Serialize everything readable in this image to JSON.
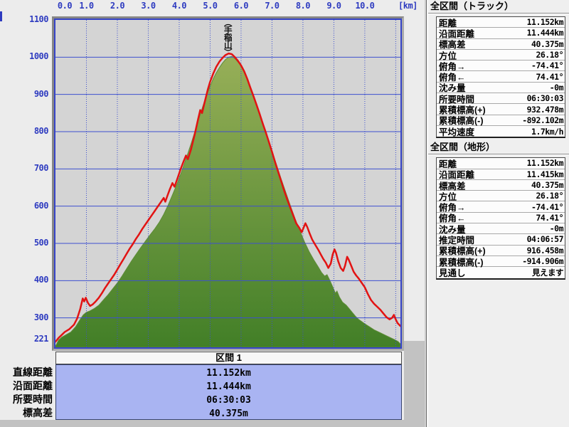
{
  "chart": {
    "x_unit_label": "[km]"
  },
  "chart_data": {
    "type": "area",
    "title": "",
    "xlabel": "[km]",
    "ylabel": "",
    "xlim": [
      0,
      11.152
    ],
    "ylim": [
      221,
      1100
    ],
    "x_ticks": [
      "0.0",
      "1.0",
      "2.0",
      "3.0",
      "4.0",
      "5.0",
      "6.0",
      "7.0",
      "8.0",
      "9.0",
      "10.0"
    ],
    "y_ticks": [
      "1100",
      "1000",
      "900",
      "800",
      "700",
      "600",
      "500",
      "400",
      "300",
      "221"
    ],
    "grid": true,
    "legend": "none",
    "annotations": [
      {
        "x": 5.56,
        "label": "（手稲山）"
      }
    ],
    "colors": {
      "axis_label": "#2e3bc0",
      "grid": "#3e50cf",
      "plot_bg": "#d4d4d4",
      "terrain_top": "#97af58",
      "terrain_bottom": "#427f27",
      "terrain_edge": "#5d8c36",
      "track": "#e21313",
      "section_value_bg": "#a9b4f2"
    },
    "series": [
      {
        "name": "地形",
        "style": "area-gradient",
        "points": [
          [
            0,
            224
          ],
          [
            0.05,
            232
          ],
          [
            0.1,
            240
          ],
          [
            0.2,
            248
          ],
          [
            0.35,
            255
          ],
          [
            0.5,
            262
          ],
          [
            0.65,
            276
          ],
          [
            0.8,
            296
          ],
          [
            0.9,
            308
          ],
          [
            1.0,
            315
          ],
          [
            1.1,
            318
          ],
          [
            1.25,
            325
          ],
          [
            1.4,
            334
          ],
          [
            1.55,
            348
          ],
          [
            1.7,
            362
          ],
          [
            1.85,
            378
          ],
          [
            2.0,
            394
          ],
          [
            2.15,
            412
          ],
          [
            2.3,
            432
          ],
          [
            2.45,
            452
          ],
          [
            2.6,
            470
          ],
          [
            2.75,
            488
          ],
          [
            2.9,
            505
          ],
          [
            3.05,
            522
          ],
          [
            3.2,
            538
          ],
          [
            3.35,
            556
          ],
          [
            3.5,
            578
          ],
          [
            3.65,
            604
          ],
          [
            3.8,
            634
          ],
          [
            3.95,
            664
          ],
          [
            4.1,
            698
          ],
          [
            4.25,
            734
          ],
          [
            4.4,
            772
          ],
          [
            4.55,
            812
          ],
          [
            4.7,
            852
          ],
          [
            4.85,
            890
          ],
          [
            5.0,
            922
          ],
          [
            5.1,
            942
          ],
          [
            5.2,
            958
          ],
          [
            5.3,
            972
          ],
          [
            5.4,
            984
          ],
          [
            5.5,
            994
          ],
          [
            5.6,
            1000
          ],
          [
            5.7,
            1002
          ],
          [
            5.78,
            998
          ],
          [
            5.85,
            992
          ],
          [
            5.95,
            982
          ],
          [
            6.05,
            968
          ],
          [
            6.15,
            950
          ],
          [
            6.25,
            928
          ],
          [
            6.4,
            894
          ],
          [
            6.55,
            860
          ],
          [
            6.7,
            824
          ],
          [
            6.85,
            786
          ],
          [
            7.0,
            748
          ],
          [
            7.15,
            710
          ],
          [
            7.3,
            672
          ],
          [
            7.45,
            636
          ],
          [
            7.6,
            600
          ],
          [
            7.75,
            566
          ],
          [
            7.9,
            534
          ],
          [
            8.05,
            504
          ],
          [
            8.2,
            478
          ],
          [
            8.35,
            456
          ],
          [
            8.5,
            436
          ],
          [
            8.6,
            422
          ],
          [
            8.7,
            412
          ],
          [
            8.78,
            416
          ],
          [
            8.85,
            404
          ],
          [
            8.95,
            386
          ],
          [
            9.05,
            366
          ],
          [
            9.1,
            372
          ],
          [
            9.18,
            356
          ],
          [
            9.28,
            342
          ],
          [
            9.4,
            334
          ],
          [
            9.5,
            324
          ],
          [
            9.6,
            314
          ],
          [
            9.7,
            304
          ],
          [
            9.8,
            296
          ],
          [
            9.9,
            290
          ],
          [
            10.0,
            284
          ],
          [
            10.15,
            276
          ],
          [
            10.3,
            268
          ],
          [
            10.5,
            260
          ],
          [
            10.7,
            252
          ],
          [
            10.9,
            244
          ],
          [
            11.0,
            240
          ],
          [
            11.08,
            236
          ],
          [
            11.152,
            230
          ]
        ]
      },
      {
        "name": "トラック",
        "style": "line",
        "points": [
          [
            0,
            236
          ],
          [
            0.1,
            246
          ],
          [
            0.2,
            254
          ],
          [
            0.3,
            262
          ],
          [
            0.45,
            270
          ],
          [
            0.6,
            282
          ],
          [
            0.7,
            298
          ],
          [
            0.8,
            324
          ],
          [
            0.88,
            352
          ],
          [
            0.93,
            344
          ],
          [
            0.98,
            354
          ],
          [
            1.05,
            340
          ],
          [
            1.12,
            332
          ],
          [
            1.2,
            336
          ],
          [
            1.3,
            344
          ],
          [
            1.4,
            354
          ],
          [
            1.5,
            366
          ],
          [
            1.6,
            380
          ],
          [
            1.7,
            392
          ],
          [
            1.8,
            404
          ],
          [
            1.9,
            416
          ],
          [
            2.0,
            430
          ],
          [
            2.1,
            444
          ],
          [
            2.2,
            458
          ],
          [
            2.3,
            472
          ],
          [
            2.4,
            486
          ],
          [
            2.5,
            498
          ],
          [
            2.6,
            512
          ],
          [
            2.7,
            524
          ],
          [
            2.8,
            538
          ],
          [
            2.9,
            550
          ],
          [
            3.0,
            562
          ],
          [
            3.1,
            574
          ],
          [
            3.2,
            586
          ],
          [
            3.3,
            598
          ],
          [
            3.4,
            610
          ],
          [
            3.5,
            622
          ],
          [
            3.55,
            612
          ],
          [
            3.62,
            628
          ],
          [
            3.7,
            646
          ],
          [
            3.78,
            662
          ],
          [
            3.85,
            652
          ],
          [
            3.95,
            676
          ],
          [
            4.05,
            700
          ],
          [
            4.15,
            722
          ],
          [
            4.22,
            736
          ],
          [
            4.28,
            726
          ],
          [
            4.38,
            752
          ],
          [
            4.5,
            792
          ],
          [
            4.6,
            830
          ],
          [
            4.68,
            858
          ],
          [
            4.74,
            850
          ],
          [
            4.82,
            878
          ],
          [
            4.92,
            912
          ],
          [
            5.0,
            934
          ],
          [
            5.1,
            956
          ],
          [
            5.2,
            974
          ],
          [
            5.3,
            988
          ],
          [
            5.4,
            998
          ],
          [
            5.5,
            1006
          ],
          [
            5.6,
            1010
          ],
          [
            5.7,
            1008
          ],
          [
            5.8,
            1000
          ],
          [
            5.9,
            990
          ],
          [
            6.0,
            978
          ],
          [
            6.1,
            962
          ],
          [
            6.2,
            942
          ],
          [
            6.3,
            918
          ],
          [
            6.4,
            896
          ],
          [
            6.5,
            872
          ],
          [
            6.6,
            848
          ],
          [
            6.7,
            822
          ],
          [
            6.8,
            798
          ],
          [
            6.9,
            772
          ],
          [
            7.0,
            746
          ],
          [
            7.1,
            718
          ],
          [
            7.2,
            692
          ],
          [
            7.3,
            666
          ],
          [
            7.4,
            640
          ],
          [
            7.5,
            616
          ],
          [
            7.6,
            594
          ],
          [
            7.7,
            572
          ],
          [
            7.78,
            554
          ],
          [
            7.88,
            542
          ],
          [
            7.96,
            530
          ],
          [
            8.02,
            542
          ],
          [
            8.08,
            554
          ],
          [
            8.14,
            544
          ],
          [
            8.22,
            526
          ],
          [
            8.3,
            510
          ],
          [
            8.4,
            496
          ],
          [
            8.5,
            482
          ],
          [
            8.58,
            470
          ],
          [
            8.66,
            458
          ],
          [
            8.74,
            448
          ],
          [
            8.82,
            434
          ],
          [
            8.9,
            446
          ],
          [
            8.96,
            470
          ],
          [
            9.02,
            484
          ],
          [
            9.07,
            474
          ],
          [
            9.14,
            452
          ],
          [
            9.22,
            434
          ],
          [
            9.3,
            426
          ],
          [
            9.36,
            440
          ],
          [
            9.43,
            464
          ],
          [
            9.48,
            456
          ],
          [
            9.56,
            440
          ],
          [
            9.64,
            424
          ],
          [
            9.72,
            414
          ],
          [
            9.8,
            406
          ],
          [
            9.9,
            394
          ],
          [
            10.0,
            382
          ],
          [
            10.1,
            364
          ],
          [
            10.2,
            348
          ],
          [
            10.3,
            338
          ],
          [
            10.4,
            330
          ],
          [
            10.5,
            322
          ],
          [
            10.6,
            312
          ],
          [
            10.7,
            302
          ],
          [
            10.8,
            296
          ],
          [
            10.88,
            300
          ],
          [
            10.94,
            308
          ],
          [
            11.0,
            296
          ],
          [
            11.06,
            286
          ],
          [
            11.152,
            278
          ]
        ]
      }
    ]
  },
  "section_panel": {
    "header": "区間 1",
    "rows": [
      {
        "label": "直線距離",
        "value": "11.152km"
      },
      {
        "label": "沿面距離",
        "value": "11.444km"
      },
      {
        "label": "所要時間",
        "value": "06:30:03"
      },
      {
        "label": "標高差",
        "value": "40.375m"
      }
    ]
  },
  "info_panels": [
    {
      "title": "全区間（トラック）",
      "rows": [
        {
          "label": "距離",
          "value": "11.152km"
        },
        {
          "label": "沿面距離",
          "value": "11.444km"
        },
        {
          "label": "標高差",
          "value": "40.375m"
        },
        {
          "label": "方位",
          "value": "26.18°"
        },
        {
          "label": "俯角→",
          "value": "-74.41°"
        },
        {
          "label": "俯角←",
          "value": "74.41°"
        },
        {
          "label": "沈み量",
          "value": "-0m"
        },
        {
          "label": "所要時間",
          "value": "06:30:03"
        },
        {
          "label": "累積標高(+)",
          "value": "932.478m"
        },
        {
          "label": "累積標高(-)",
          "value": "-892.102m"
        },
        {
          "label": "平均速度",
          "value": "1.7km/h"
        }
      ]
    },
    {
      "title": "全区間（地形）",
      "rows": [
        {
          "label": "距離",
          "value": "11.152km"
        },
        {
          "label": "沿面距離",
          "value": "11.415km"
        },
        {
          "label": "標高差",
          "value": "40.375m"
        },
        {
          "label": "方位",
          "value": "26.18°"
        },
        {
          "label": "俯角→",
          "value": "-74.41°"
        },
        {
          "label": "俯角←",
          "value": "74.41°"
        },
        {
          "label": "沈み量",
          "value": "-0m"
        },
        {
          "label": "推定時間",
          "value": "04:06:57"
        },
        {
          "label": "累積標高(+)",
          "value": "916.458m"
        },
        {
          "label": "累積標高(-)",
          "value": "-914.906m"
        },
        {
          "label": "見通し",
          "value": "見えます"
        }
      ]
    }
  ]
}
